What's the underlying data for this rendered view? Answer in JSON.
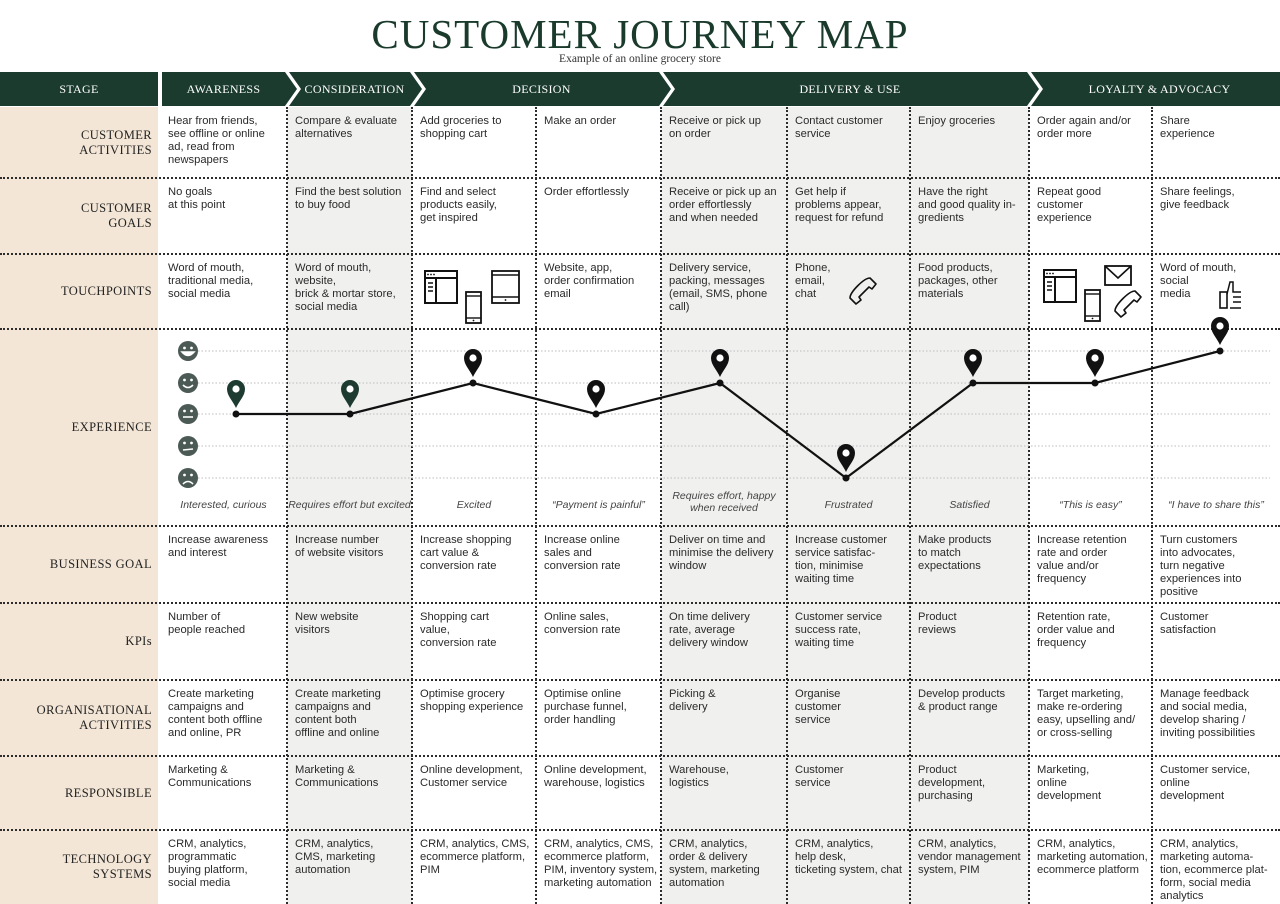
{
  "header": {
    "title": "CUSTOMER JOURNEY MAP",
    "subtitle": "Example of an online grocery store"
  },
  "colors": {
    "header_bg": "#1b3b2f",
    "label_column_bg": "#f3e6d6",
    "shaded_column_bg": "#f0f1ef",
    "line": "#111111",
    "pin_dark_green": "#1e3b31",
    "pin_black": "#111111",
    "emoji_face": "#4b5a55"
  },
  "stage_label": "STAGE",
  "stages": [
    {
      "label": "AWARENESS"
    },
    {
      "label": "CONSIDERATION"
    },
    {
      "label": "DECISION"
    },
    {
      "label": "DELIVERY & USE"
    },
    {
      "label": "LOYALTY  & ADVOCACY"
    }
  ],
  "row_labels": {
    "customer_activities": "CUSTOMER\nACTIVITIES",
    "customer_goals": "CUSTOMER\nGOALS",
    "touchpoints": "TOUCHPOINTS",
    "experience": "EXPERIENCE",
    "business_goal": "BUSINESS GOAL",
    "kpis": "KPIs",
    "organisational_activities": "ORGANISATIONAL\nACTIVITIES",
    "responsible": "RESPONSIBLE",
    "technology_systems": "TECHNOLOGY\nSYSTEMS"
  },
  "rows": {
    "customer_activities": [
      "Hear from friends,\nsee offline or online\nad, read from\nnewspapers",
      "Compare & evaluate\nalternatives",
      "Add groceries to\nshopping cart",
      "Make an order",
      "Receive or pick up\non order",
      "Contact customer\nservice",
      "Enjoy groceries",
      "Order again and/or\norder more",
      "Share\nexperience"
    ],
    "customer_goals": [
      "No goals\nat this point",
      "Find the best solution\nto buy food",
      "Find and select\nproducts easily,\nget inspired",
      "Order effortlessly",
      "Receive or pick up an\norder effortlessly\nand when needed",
      "Get help if\nproblems appear,\nrequest for refund",
      "Have the right\nand good quality in-\ngredients",
      "Repeat good\ncustomer\nexperience",
      "Share feelings,\ngive feedback"
    ],
    "touchpoints": [
      {
        "text": "Word of mouth,\ntraditional media,\nsocial media",
        "icons": []
      },
      {
        "text": "Word of mouth,\nwebsite,\nbrick & mortar store,\nsocial media",
        "icons": []
      },
      {
        "text": "",
        "icons": [
          "browser-window-icon",
          "smartphone-icon",
          "tablet-icon"
        ]
      },
      {
        "text": "Website, app,\norder confirmation\nemail",
        "icons": []
      },
      {
        "text": "Delivery service,\npacking, messages\n(email, SMS, phone\ncall)",
        "icons": []
      },
      {
        "text": "Phone,\nemail,\nchat",
        "icons": [
          "phone-handset-icon"
        ]
      },
      {
        "text": "Food products,\npackages, other\nmaterials",
        "icons": []
      },
      {
        "text": "",
        "icons": [
          "browser-window-icon",
          "envelope-icon",
          "smartphone-icon",
          "phone-handset-icon"
        ]
      },
      {
        "text": "Word of mouth,\nsocial\nmedia",
        "icons": [
          "thumbs-up-icon"
        ]
      }
    ],
    "business_goal": [
      "Increase awareness\nand interest",
      "Increase number\nof website visitors",
      "Increase shopping\ncart value &\nconversion rate",
      "Increase online\nsales and\nconversion rate",
      "Deliver on time and\nminimise the delivery\nwindow",
      "Increase customer\nservice satisfac-\ntion, minimise\nwaiting time",
      "Make products\nto match\nexpectations",
      "Increase retention\nrate and order\nvalue and/or\nfrequency",
      "Turn customers\ninto advocates,\nturn negative\nexperiences into\npositive"
    ],
    "kpis": [
      "Number of\npeople reached",
      "New website\nvisitors",
      "Shopping cart\nvalue,\nconversion rate",
      "Online sales,\nconversion rate",
      "On time delivery\nrate, average\ndelivery window",
      "Customer service\nsuccess rate,\nwaiting time",
      "Product\nreviews",
      "Retention rate,\norder value and\nfrequency",
      "Customer\nsatisfaction"
    ],
    "organisational_activities": [
      "Create marketing\ncampaigns and\ncontent both offline\nand online, PR",
      "Create marketing\ncampaigns and\ncontent both\noffline and online",
      "Optimise grocery\nshopping experience",
      "Optimise online\npurchase funnel,\norder handling",
      "Picking &\ndelivery",
      "Organise\ncustomer\nservice",
      "Develop products\n& product range",
      "Target marketing,\nmake re-ordering\neasy, upselling and/\nor cross-selling",
      "Manage feedback\nand social media,\ndevelop sharing /\ninviting possibilities"
    ],
    "responsible": [
      "Marketing &\nCommunications",
      "Marketing &\nCommunications",
      "Online development,\nCustomer service",
      "Online development,\nwarehouse, logistics",
      "Warehouse,\nlogistics",
      "Customer\nservice",
      "Product\ndevelopment,\npurchasing",
      "Marketing,\nonline\ndevelopment",
      "Customer service,\nonline\ndevelopment"
    ],
    "technology_systems": [
      "CRM, analytics,\nprogrammatic\nbuying platform,\nsocial media",
      "CRM, analytics,\nCMS, marketing\nautomation",
      "CRM, analytics, CMS,\necommerce platform,\nPIM",
      "CRM, analytics, CMS,\necommerce platform,\nPIM, inventory system,\nmarketing automation",
      "CRM, analytics,\norder & delivery\nsystem, marketing\nautomation",
      "CRM, analytics,\nhelp desk,\nticketing system, chat",
      "CRM, analytics,\nvendor management\nsystem, PIM",
      "CRM, analytics,\nmarketing automation,\necommerce platform",
      "CRM, analytics,\nmarketing automa-\ntion, ecommerce plat-\nform, social media\nanalytics"
    ]
  },
  "experience": {
    "scale_icons": [
      "very-happy-face-icon",
      "happy-face-icon",
      "neutral-face-icon",
      "slightly-sad-face-icon",
      "sad-face-icon"
    ],
    "scale_max": 5,
    "levels": [
      3,
      3,
      4,
      3,
      4,
      1,
      4,
      4,
      5
    ],
    "pin_colors": [
      "green",
      "green",
      "black",
      "black",
      "black",
      "black",
      "black",
      "black",
      "black"
    ],
    "emotions": [
      "Interested, curious",
      "Requires effort but excited",
      "Excited",
      "“Payment is painful”",
      "Requires effort, happy\nwhen received",
      "Frustrated",
      "Satisfied",
      "“This is easy”",
      "“I have to share this”"
    ]
  }
}
